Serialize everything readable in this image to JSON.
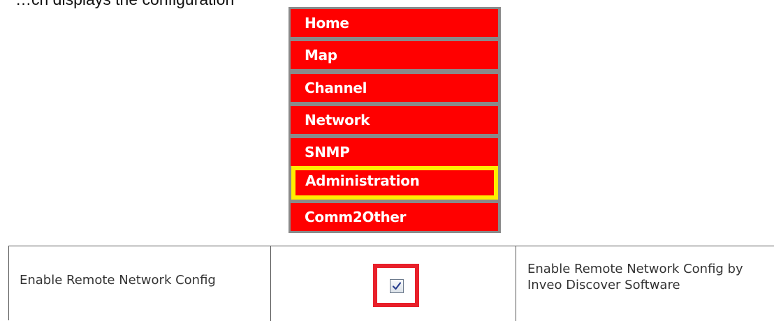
{
  "intro_text": "…ch displays the configuration",
  "menu": {
    "items": [
      {
        "label": "Home",
        "highlighted": false
      },
      {
        "label": "Map",
        "highlighted": false
      },
      {
        "label": "Channel",
        "highlighted": false
      },
      {
        "label": "Network",
        "highlighted": false
      },
      {
        "label": "SNMP",
        "highlighted": false
      },
      {
        "label": "Administration",
        "highlighted": true
      },
      {
        "label": "Comm2Other",
        "highlighted": false
      }
    ],
    "item_color": "#ff0000",
    "highlight_color": "#ffee00"
  },
  "settings": {
    "row": {
      "label": "Enable Remote Network Config",
      "checked": true,
      "description": "Enable Remote Network Config by Inveo Discover Software"
    },
    "checkbox_highlight_color": "#e8202a"
  },
  "icons": {
    "checkmark": "check-icon"
  }
}
